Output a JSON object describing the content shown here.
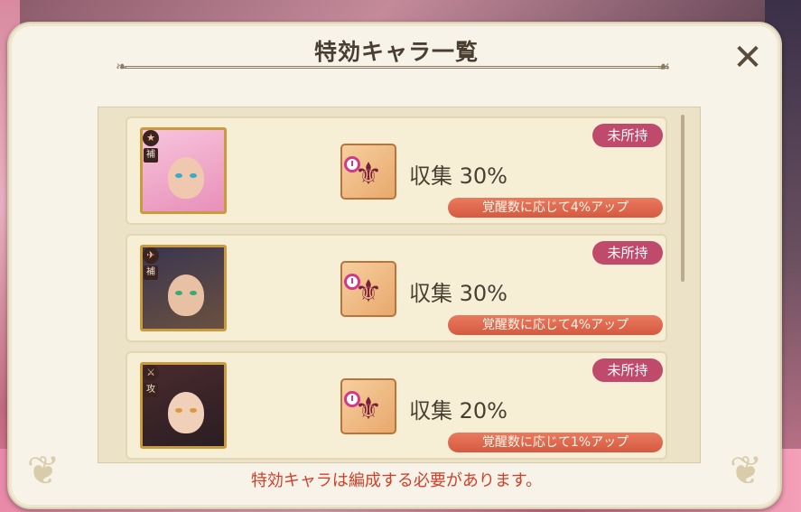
{
  "dialog": {
    "title": "特効キャラ一覧",
    "close_glyph": "✕",
    "footer_note": "特効キャラは編成する必要があります。"
  },
  "characters": [
    {
      "role_icon": "star-icon",
      "role_label": "補",
      "owned_status": "未所持",
      "effect": "収集 30%",
      "bonus": "覚醒数に応じて4%アップ",
      "portrait_colors": {
        "bg": "#f2a8c8",
        "hair": "#f6b8d8",
        "eyes": "#3aa8c8"
      }
    },
    {
      "role_icon": "wing-icon",
      "role_label": "補",
      "owned_status": "未所持",
      "effect": "収集 30%",
      "bonus": "覚醒数に応じて4%アップ",
      "portrait_colors": {
        "bg": "#3a3650",
        "hair": "#2a2a3e",
        "eyes": "#3aa878"
      }
    },
    {
      "role_icon": "sword-icon",
      "role_label": "攻",
      "owned_status": "未所持",
      "effect": "収集 20%",
      "bonus": "覚醒数に応じて1%アップ",
      "portrait_colors": {
        "bg": "#3a2a2e",
        "hair": "#1e1a20",
        "eyes": "#d89a3a"
      }
    }
  ],
  "colors": {
    "owned_badge": "#c04a6c",
    "bonus_bar": "#d45a40",
    "footer_text": "#d0402a"
  }
}
